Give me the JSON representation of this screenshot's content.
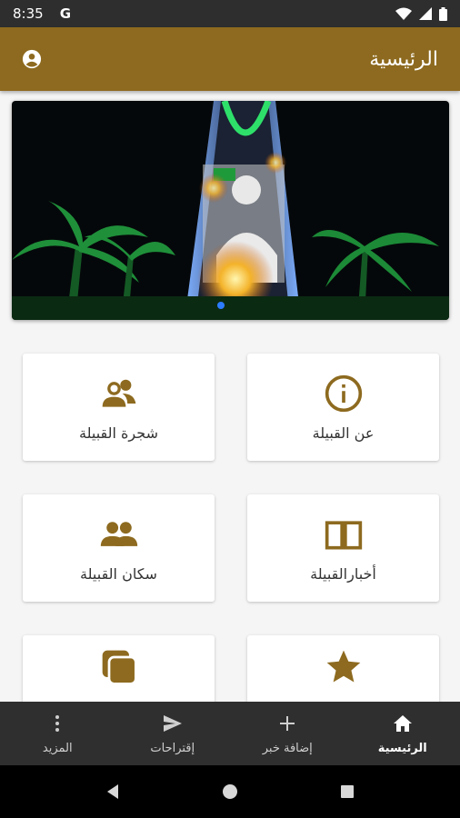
{
  "status_bar": {
    "time": "8:35",
    "g_icon_label": "G"
  },
  "app_bar": {
    "title": "الرئيسية"
  },
  "cards": [
    {
      "label": "عن القبيلة",
      "icon": "info-icon"
    },
    {
      "label": "شجرة القبيلة",
      "icon": "people-talk-icon"
    },
    {
      "label": "أخبارالقبيلة",
      "icon": "book-icon"
    },
    {
      "label": "سكان القبيلة",
      "icon": "people-icon"
    },
    {
      "label": "",
      "icon": "star-icon"
    },
    {
      "label": "",
      "icon": "layers-icon"
    }
  ],
  "bottom_nav": [
    {
      "label": "الرئيسية",
      "icon": "home-icon",
      "active": true
    },
    {
      "label": "إضافة خبر",
      "icon": "plus-icon",
      "active": false
    },
    {
      "label": "إقتراحات",
      "icon": "send-icon",
      "active": false
    },
    {
      "label": "المزيد",
      "icon": "more-vert-icon",
      "active": false
    }
  ],
  "colors": {
    "brand": "#8d6a1f",
    "nav_bg": "#2f2f2f",
    "status_bg": "#2e2e2e"
  }
}
